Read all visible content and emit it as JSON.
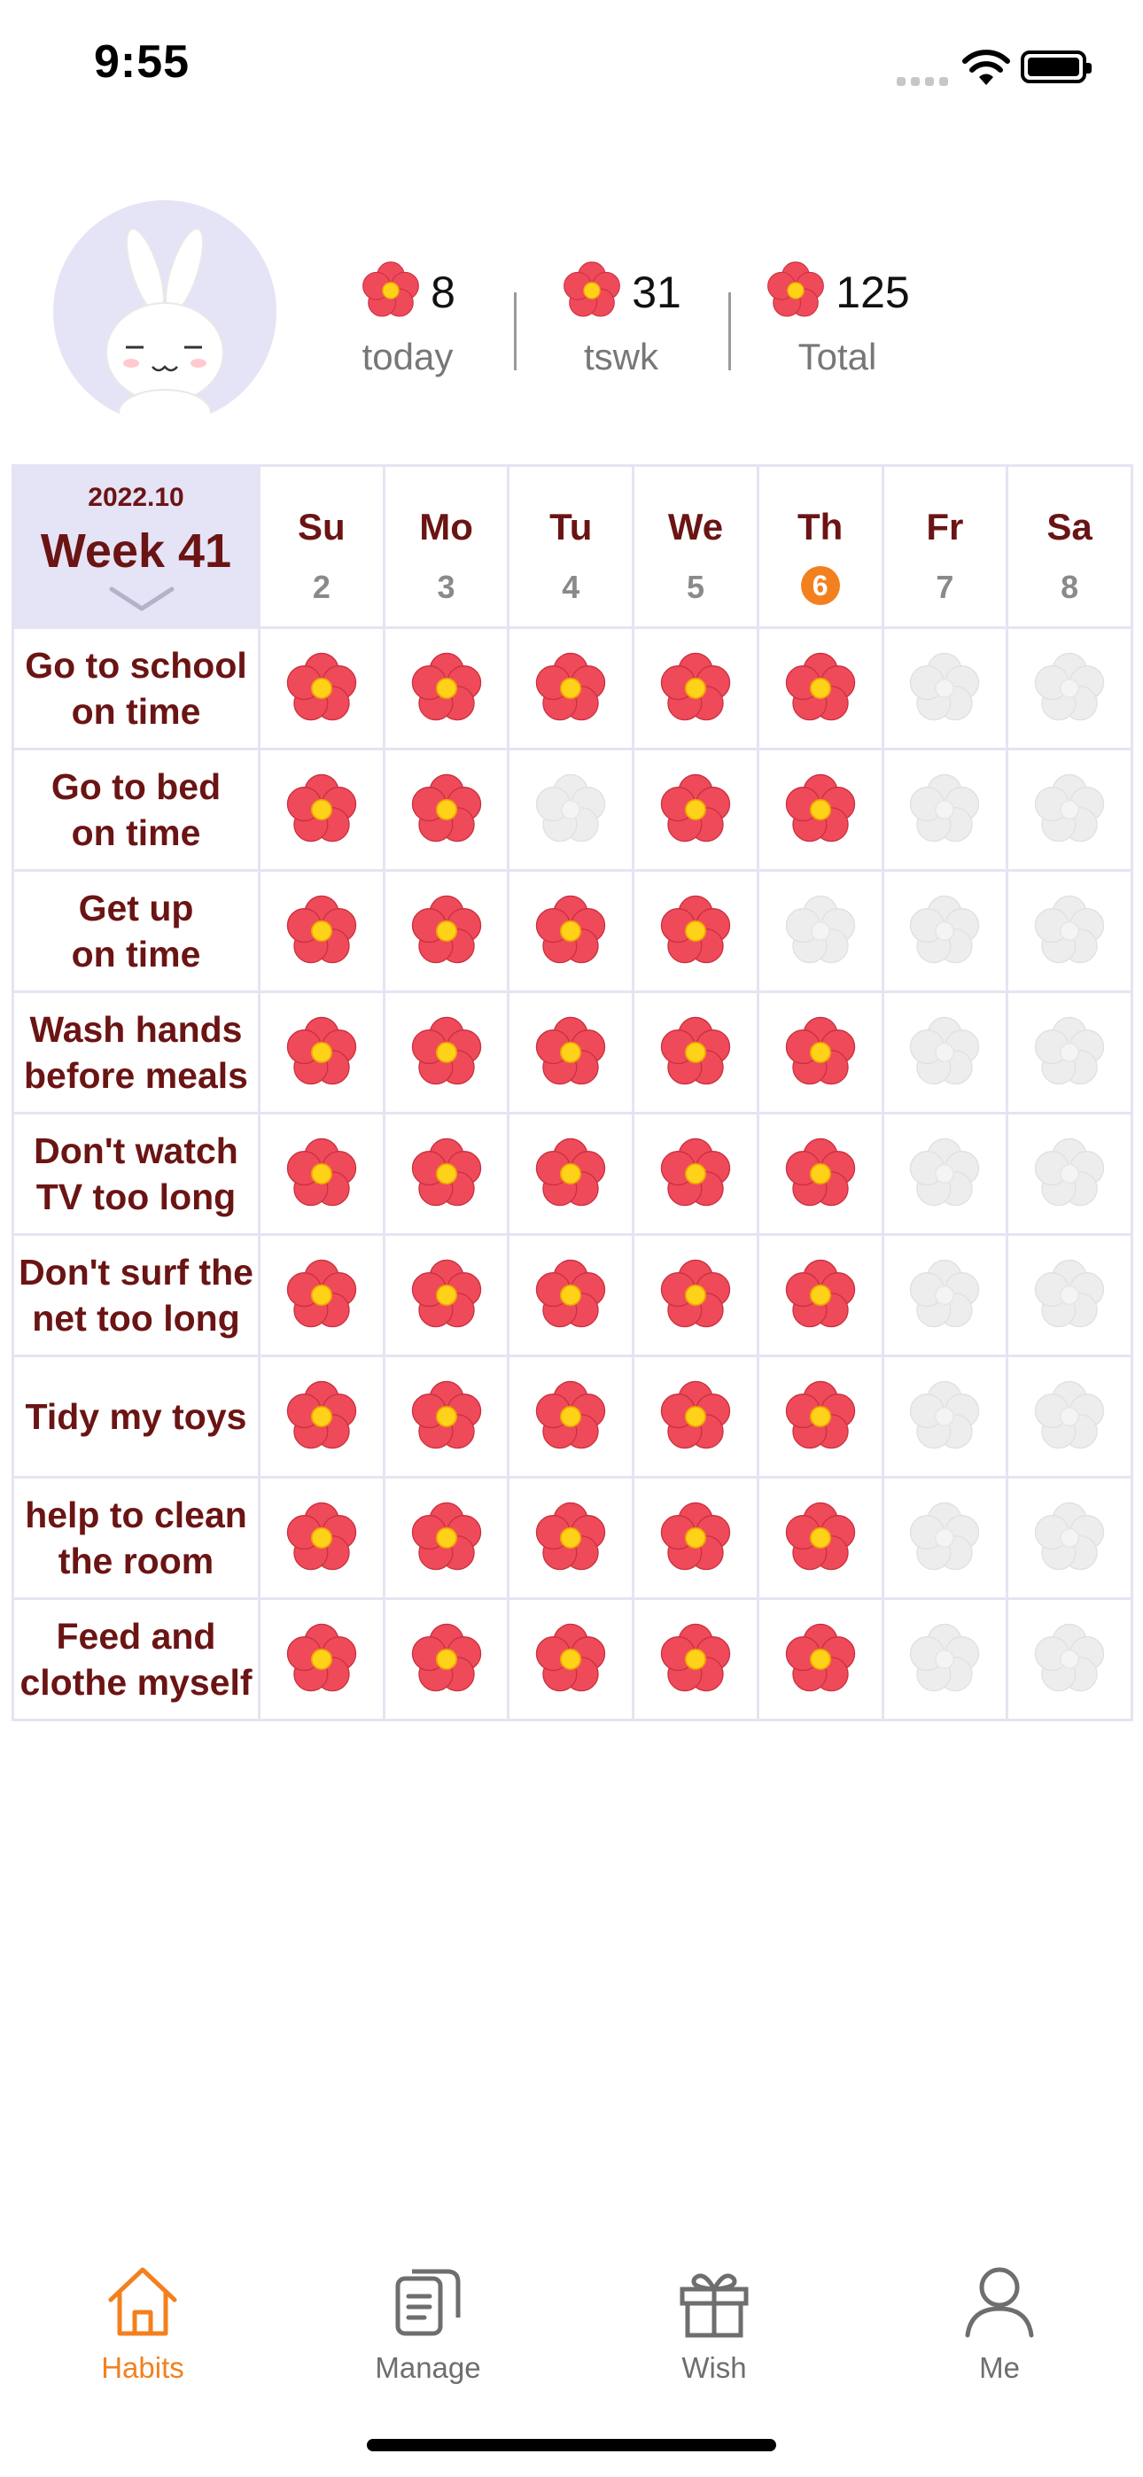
{
  "status_bar": {
    "time": "9:55"
  },
  "header": {
    "stats": [
      {
        "value": "8",
        "label": "today"
      },
      {
        "value": "31",
        "label": "tswk"
      },
      {
        "value": "125",
        "label": "Total"
      }
    ]
  },
  "grid": {
    "year_month": "2022.10",
    "week_label": "Week 41",
    "days": [
      {
        "name": "Su",
        "date": "2",
        "today": false
      },
      {
        "name": "Mo",
        "date": "3",
        "today": false
      },
      {
        "name": "Tu",
        "date": "4",
        "today": false
      },
      {
        "name": "We",
        "date": "5",
        "today": false
      },
      {
        "name": "Th",
        "date": "6",
        "today": true
      },
      {
        "name": "Fr",
        "date": "7",
        "today": false
      },
      {
        "name": "Sa",
        "date": "8",
        "today": false
      }
    ],
    "habits": [
      {
        "name": "Go to school\non time",
        "done": [
          1,
          1,
          1,
          1,
          1,
          0,
          0
        ]
      },
      {
        "name": "Go to bed\non time",
        "done": [
          1,
          1,
          0,
          1,
          1,
          0,
          0
        ]
      },
      {
        "name": "Get up\non time",
        "done": [
          1,
          1,
          1,
          1,
          0,
          0,
          0
        ]
      },
      {
        "name": "Wash hands\nbefore meals",
        "done": [
          1,
          1,
          1,
          1,
          1,
          0,
          0
        ]
      },
      {
        "name": "Don't watch\nTV too long",
        "done": [
          1,
          1,
          1,
          1,
          1,
          0,
          0
        ]
      },
      {
        "name": "Don't surf the\nnet too long",
        "done": [
          1,
          1,
          1,
          1,
          1,
          0,
          0
        ]
      },
      {
        "name": "Tidy my toys",
        "done": [
          1,
          1,
          1,
          1,
          1,
          0,
          0
        ]
      },
      {
        "name": "help to clean\nthe room",
        "done": [
          1,
          1,
          1,
          1,
          1,
          0,
          0
        ]
      },
      {
        "name": "Feed and\nclothe myself",
        "done": [
          1,
          1,
          1,
          1,
          1,
          0,
          0
        ]
      }
    ]
  },
  "tabbar": {
    "tabs": [
      {
        "label": "Habits",
        "icon": "home-icon",
        "active": true
      },
      {
        "label": "Manage",
        "icon": "documents-icon",
        "active": false
      },
      {
        "label": "Wish",
        "icon": "gift-icon",
        "active": false
      },
      {
        "label": "Me",
        "icon": "person-icon",
        "active": false
      }
    ]
  },
  "colors": {
    "accent": "#f3801f",
    "habit_text": "#6b1414",
    "week_bg": "#e5e3f6",
    "flower_red": "#ef4a5a",
    "flower_grey": "#ededed"
  }
}
